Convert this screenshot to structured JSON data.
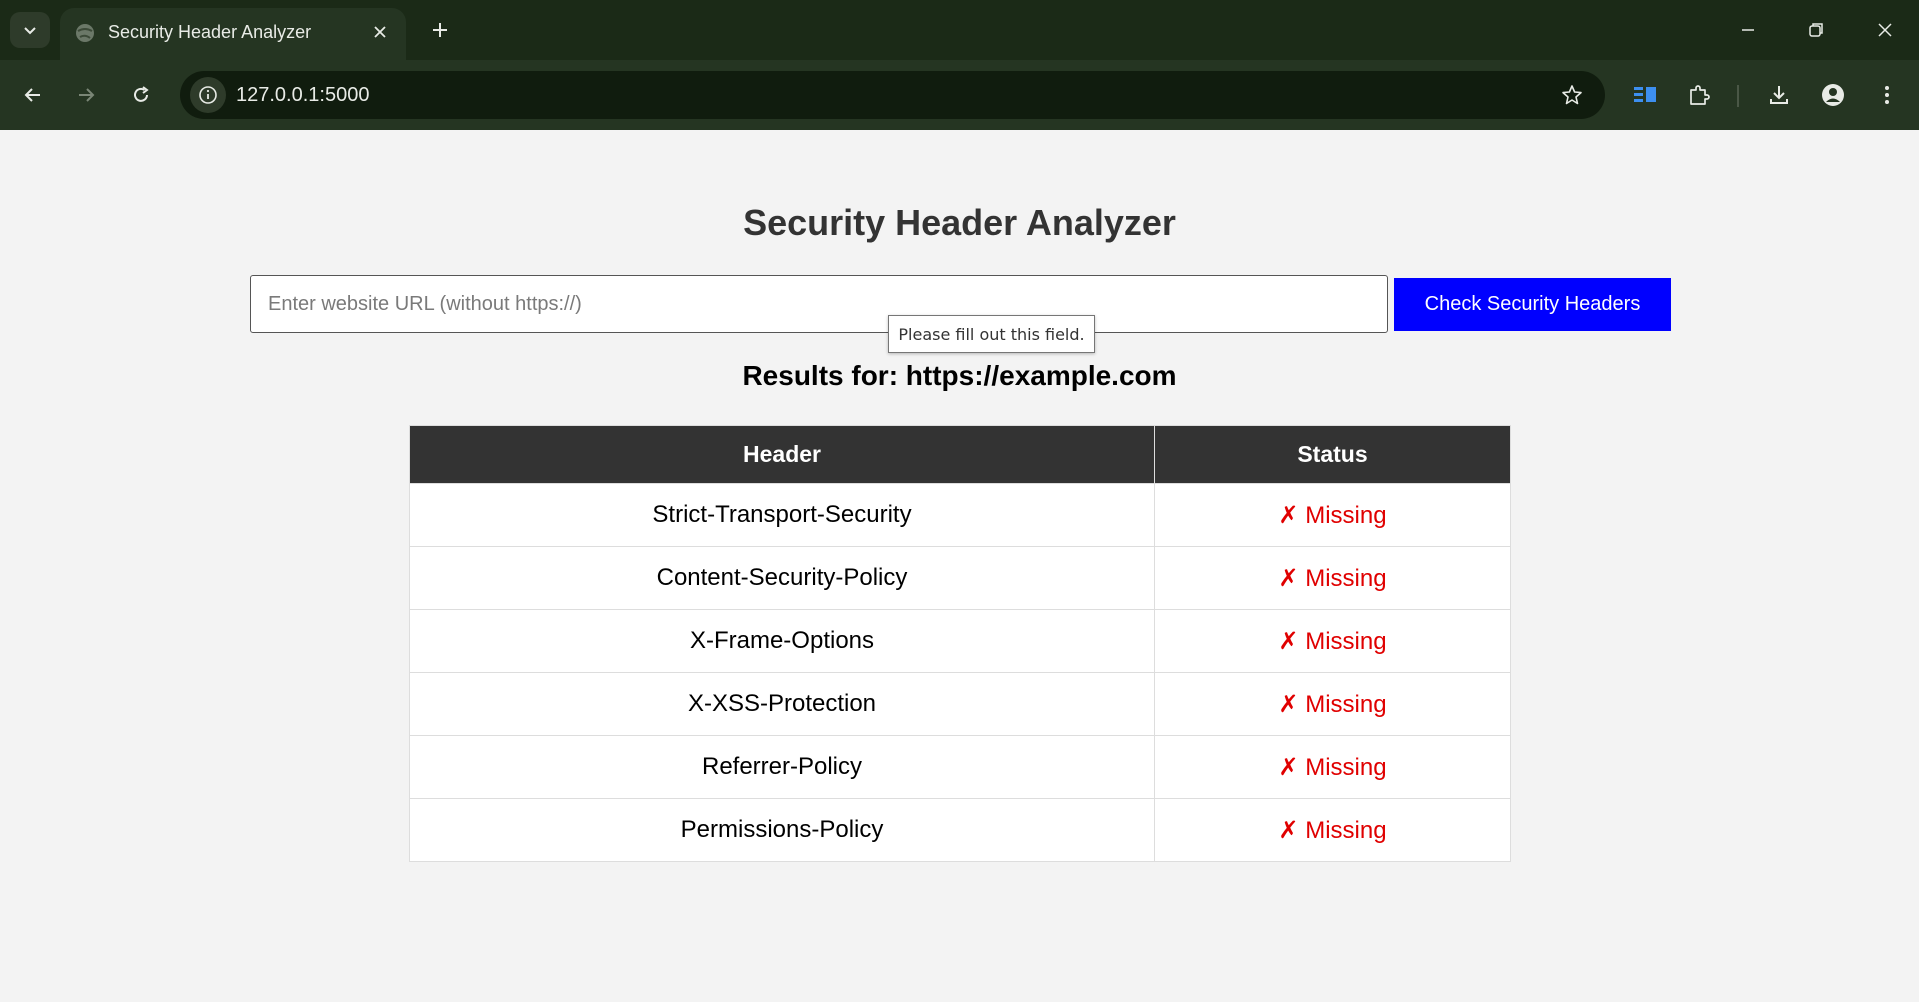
{
  "browser": {
    "tab_title": "Security Header Analyzer",
    "url": "127.0.0.1:5000"
  },
  "page": {
    "title": "Security Header Analyzer",
    "search": {
      "placeholder": "Enter website URL (without https://)",
      "value": "",
      "button_label": "Check Security Headers",
      "validation_tooltip": "Please fill out this field."
    },
    "results_heading": "Results for: https://example.com",
    "table": {
      "columns": [
        "Header",
        "Status"
      ],
      "rows": [
        {
          "header": "Strict-Transport-Security",
          "status": "✗ Missing"
        },
        {
          "header": "Content-Security-Policy",
          "status": "✗ Missing"
        },
        {
          "header": "X-Frame-Options",
          "status": "✗ Missing"
        },
        {
          "header": "X-XSS-Protection",
          "status": "✗ Missing"
        },
        {
          "header": "Referrer-Policy",
          "status": "✗ Missing"
        },
        {
          "header": "Permissions-Policy",
          "status": "✗ Missing"
        }
      ]
    }
  },
  "colors": {
    "button_bg": "#0000ff",
    "table_header_bg": "#333333",
    "missing_status": "#e00000"
  }
}
